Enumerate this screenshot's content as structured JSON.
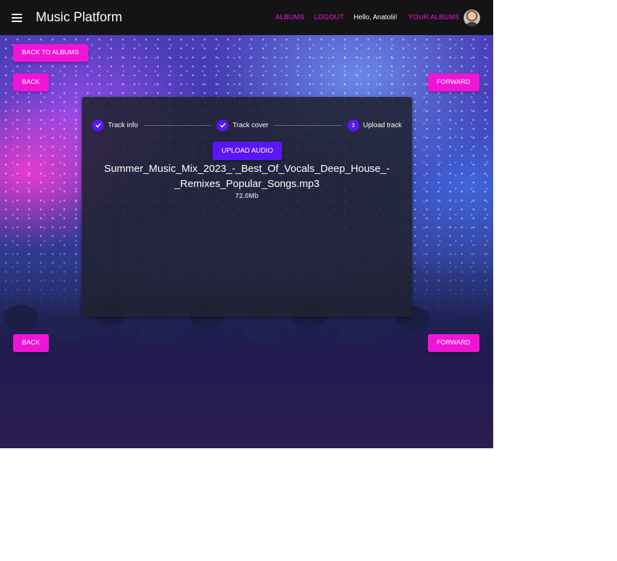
{
  "header": {
    "brand": "Music Platform",
    "nav": {
      "albums": "ALBUMS",
      "logout": "LOGOUT",
      "greeting": "Hello, Anatolii!",
      "your_albums": "YOUR ALBUMS"
    }
  },
  "actions": {
    "back_to_albums": "BACK TO ALBUMS",
    "back": "BACK",
    "forward": "FORWARD"
  },
  "stepper": {
    "steps": [
      {
        "label": "Track info",
        "state": "completed"
      },
      {
        "label": "Track cover",
        "state": "completed"
      },
      {
        "label": "Upload track",
        "state": "active",
        "number": "3"
      }
    ]
  },
  "upload": {
    "button_label": "UPLOAD AUDIO",
    "file_name": "Summer_Music_Mix_2023_-_Best_Of_Vocals_Deep_House_-_Remixes_Popular_Songs.mp3",
    "file_size": "72.0Mb"
  },
  "colors": {
    "accent_pink": "#f014d6",
    "accent_purple": "#5a16f5",
    "topbar": "#141414"
  }
}
